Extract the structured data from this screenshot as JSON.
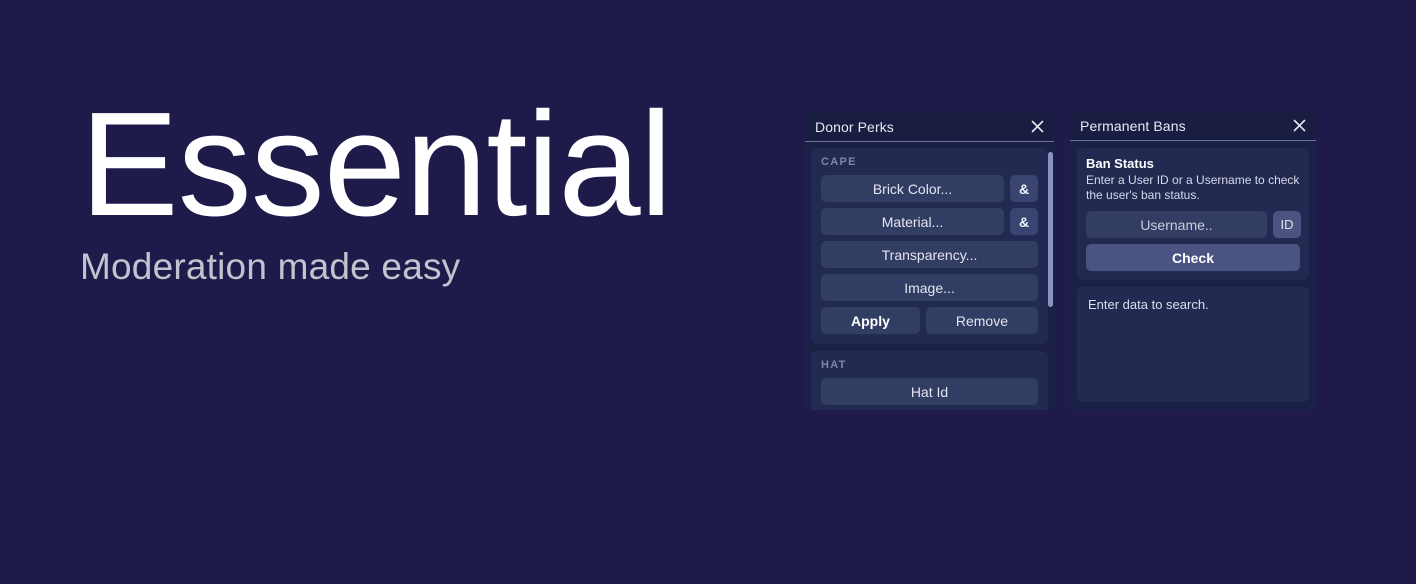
{
  "hero": {
    "title": "Essential",
    "subtitle": "Moderation made easy"
  },
  "colors": {
    "background": "#1e1b4b",
    "panel_bg": "#1b2047",
    "panel_titlebar": "#181d41",
    "card_bg": "#222a52",
    "button": "#323d63",
    "button_accent": "#4b5480",
    "label_muted": "#7e86ad",
    "text_primary": "#ffffff"
  },
  "donor_perks": {
    "title": "Donor Perks",
    "close_icon": "close-icon",
    "scrollbar": {
      "visible": true
    },
    "sections": [
      {
        "label": "CAPE",
        "rows": [
          {
            "button": "Brick Color...",
            "suffix": "&"
          },
          {
            "button": "Material...",
            "suffix": "&"
          },
          {
            "button": "Transparency...",
            "suffix": null
          },
          {
            "button": "Image...",
            "suffix": null
          }
        ],
        "actions": [
          {
            "label": "Apply",
            "bold": true
          },
          {
            "label": "Remove",
            "bold": false
          }
        ]
      },
      {
        "label": "HAT",
        "rows": [
          {
            "button": "Hat Id",
            "suffix": null
          }
        ],
        "actions": []
      }
    ]
  },
  "permanent_bans": {
    "title": "Permanent Bans",
    "close_icon": "close-icon",
    "status_card": {
      "heading": "Ban Status",
      "description": "Enter a User ID or a Username to check the user's ban status.",
      "input_value": "",
      "input_placeholder": "Username..",
      "id_button": "ID",
      "check_button": "Check"
    },
    "result_text": "Enter data to search."
  }
}
